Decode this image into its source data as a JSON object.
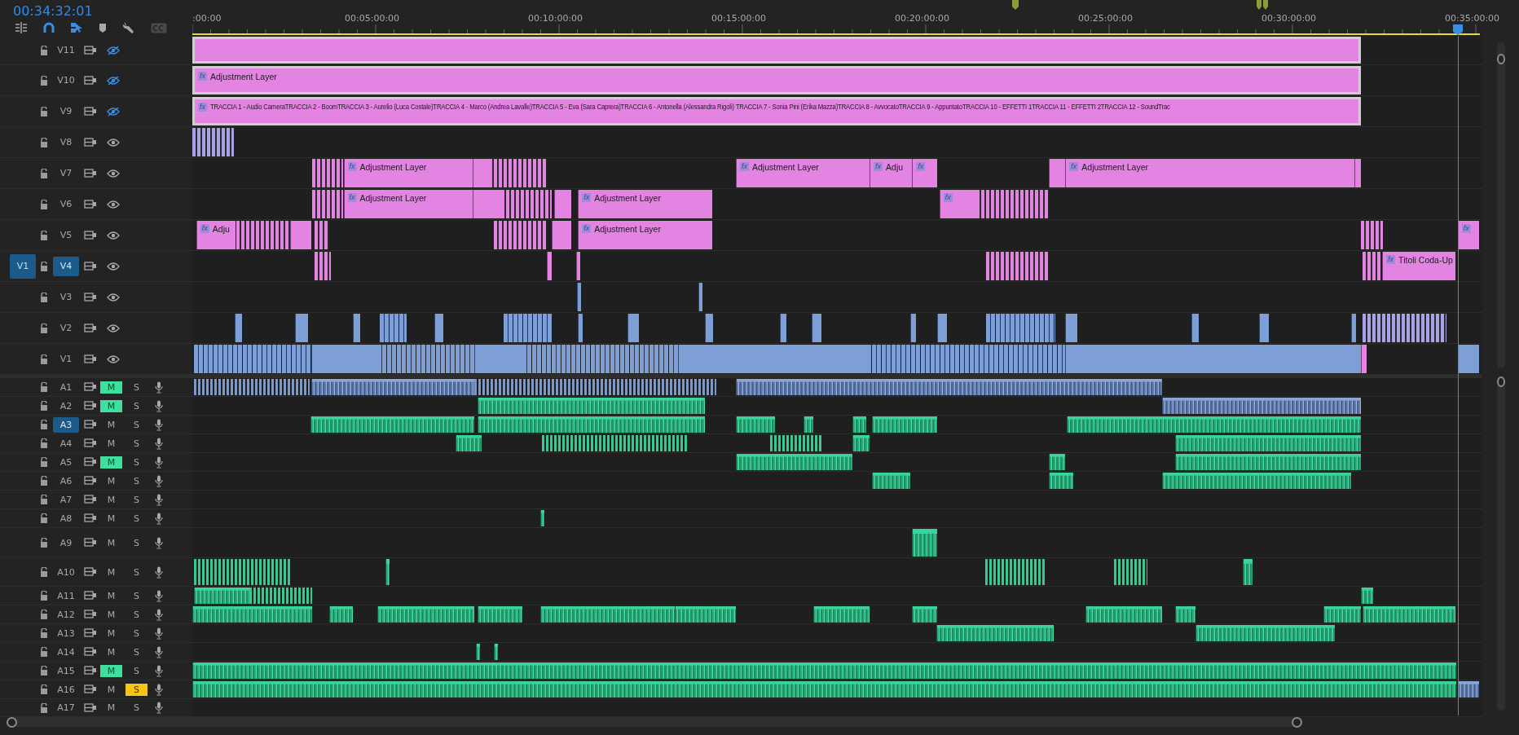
{
  "timecode": "00:34:32:01",
  "toolbar": {
    "snap": true,
    "linked_selection": true,
    "captions_enabled": false
  },
  "ruler": {
    "ticks": [
      ":00:00",
      "00:05:00:00",
      "00:10:00:00",
      "00:15:00:00",
      "00:20:00:00",
      "00:25:00:00",
      "00:30:00:00",
      "00:35:00:00"
    ]
  },
  "video_tracks": [
    {
      "name": "V11",
      "visible": false,
      "targeted": false,
      "clips": [
        {
          "selected": true
        }
      ]
    },
    {
      "name": "V10",
      "visible": false,
      "targeted": false,
      "clips": [
        {
          "badge": "fx",
          "label": "Adjustment Layer",
          "selected": true
        }
      ]
    },
    {
      "name": "V9",
      "visible": false,
      "targeted": false,
      "clips": [
        {
          "badge": "fx",
          "label": "TRACCIA 1 - Audio CameraTRACCIA 2 - BoomTRACCIA 3 - Aurelio (Luca Costale)TRACCIA 4 - Marco (Andrea Lavalle)TRACCIA 5 - Eva (Sara Caprera)TRACCIA 6 - Antonella (Alessandra Rigoli) TRACCIA 7 - Sonia Pini (Erika Mazza)TRACCIA 8 - AvvocatoTRACCIA 9 - AppuntatoTRACCIA 10 - EFFETTI 1TRACCIA 11 - EFFETTI 2TRACCIA 12 - SoundTrac",
          "selected": true
        }
      ]
    },
    {
      "name": "V8",
      "visible": true,
      "targeted": false
    },
    {
      "name": "V7",
      "visible": true,
      "targeted": false,
      "clips": [
        {
          "badge": "fx",
          "label": "Adjustment Layer",
          "selected": false
        },
        {
          "badge": "fx",
          "label": "Adjustment Layer",
          "selected": false
        },
        {
          "badge": "fx",
          "label": "Adju",
          "selected": false
        },
        {
          "badge": "fx",
          "selected": false
        },
        {
          "badge": "fx",
          "label": "Adjustment Layer",
          "selected": false
        }
      ]
    },
    {
      "name": "V6",
      "visible": true,
      "targeted": false,
      "clips": [
        {
          "badge": "fx",
          "label": "Adjustment Layer",
          "selected": false
        },
        {
          "badge": "fx",
          "label": "Adjustment Layer",
          "selected": false
        },
        {
          "badge": "fx",
          "selected": false
        }
      ]
    },
    {
      "name": "V5",
      "visible": true,
      "targeted": false,
      "clips": [
        {
          "badge": "fx",
          "label": "Adju",
          "selected": false
        },
        {
          "badge": "fx",
          "label": "Adjustment Layer",
          "selected": false
        },
        {
          "badge": "fx",
          "selected": false
        }
      ]
    },
    {
      "name": "V4",
      "source": "V1",
      "visible": true,
      "targeted": true,
      "clips": [
        {
          "badge": "fx",
          "label": "Titoli Coda-Up",
          "selected": false
        }
      ]
    },
    {
      "name": "V3",
      "visible": true,
      "targeted": false
    },
    {
      "name": "V2",
      "visible": true,
      "targeted": false
    },
    {
      "name": "V1",
      "visible": true,
      "targeted": false
    }
  ],
  "audio_tracks": [
    {
      "name": "A1",
      "targeted": false,
      "mute": "M",
      "muted": true,
      "solo": "S",
      "soloed": false
    },
    {
      "name": "A2",
      "targeted": false,
      "mute": "M",
      "muted": true,
      "solo": "S",
      "soloed": false
    },
    {
      "name": "A3",
      "targeted": true,
      "mute": "M",
      "muted": false,
      "solo": "S",
      "soloed": false
    },
    {
      "name": "A4",
      "targeted": false,
      "mute": "M",
      "muted": false,
      "solo": "S",
      "soloed": false
    },
    {
      "name": "A5",
      "targeted": false,
      "mute": "M",
      "muted": true,
      "solo": "S",
      "soloed": false
    },
    {
      "name": "A6",
      "targeted": false,
      "mute": "M",
      "muted": false,
      "solo": "S",
      "soloed": false
    },
    {
      "name": "A7",
      "targeted": false,
      "mute": "M",
      "muted": false,
      "solo": "S",
      "soloed": false
    },
    {
      "name": "A8",
      "targeted": false,
      "mute": "M",
      "muted": false,
      "solo": "S",
      "soloed": false
    },
    {
      "name": "A9",
      "targeted": false,
      "mute": "M",
      "muted": false,
      "solo": "S",
      "soloed": false
    },
    {
      "name": "A10",
      "targeted": false,
      "mute": "M",
      "muted": false,
      "solo": "S",
      "soloed": false
    },
    {
      "name": "A11",
      "targeted": false,
      "mute": "M",
      "muted": false,
      "solo": "S",
      "soloed": false
    },
    {
      "name": "A12",
      "targeted": false,
      "mute": "M",
      "muted": false,
      "solo": "S",
      "soloed": false
    },
    {
      "name": "A13",
      "targeted": false,
      "mute": "M",
      "muted": false,
      "solo": "S",
      "soloed": false
    },
    {
      "name": "A14",
      "targeted": false,
      "mute": "M",
      "muted": false,
      "solo": "S",
      "soloed": false
    },
    {
      "name": "A15",
      "targeted": false,
      "mute": "M",
      "muted": true,
      "solo": "S",
      "soloed": false
    },
    {
      "name": "A16",
      "targeted": false,
      "mute": "M",
      "muted": false,
      "solo": "S",
      "soloed": true
    },
    {
      "name": "A17",
      "targeted": false,
      "mute": "M",
      "muted": false,
      "solo": "S",
      "soloed": false
    }
  ]
}
